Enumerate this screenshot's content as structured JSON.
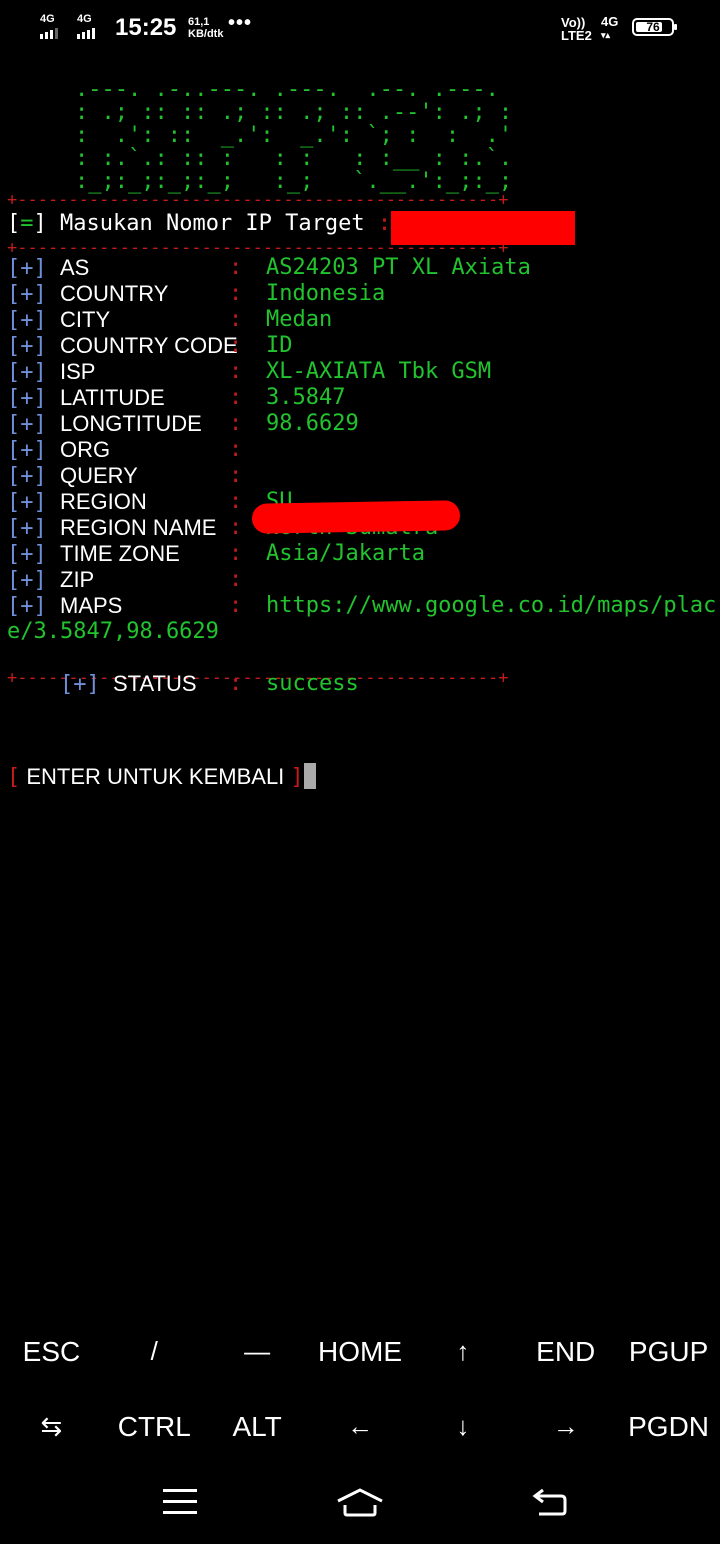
{
  "status_bar": {
    "sim1": "4G",
    "sim2": "4G",
    "time": "15:25",
    "speed_value": "61,1",
    "speed_unit": "KB/dtk",
    "more": "•••",
    "volte_top": "Vo))",
    "volte_bottom": "LTE2",
    "net_right": "4G",
    "battery": "76",
    "battery_level": 76
  },
  "terminal": {
    "ascii_art": [
      ".---. .-..---. .---.  .--. .---.",
      ": .; :: :: .; :: .; :: .--': .; :",
      ":  .': ::  _.':  _.': `; :  :  .'",
      ": :.`.: :: :   : :   : :__ : :.`.",
      ":_;:_;:_;:_;   :_;   `.__.':_;:_;"
    ],
    "dashes": "+-----------------------------------------------+",
    "prompt_bracket_open": "[",
    "prompt_mark": "=",
    "prompt_bracket_close": "]",
    "prompt_text": "Masukan Nomor IP Target",
    "prompt_colon": ":",
    "separator": ":",
    "rows": [
      {
        "mark": "[+]",
        "label": "AS",
        "value": "AS24203 PT XL Axiata"
      },
      {
        "mark": "[+]",
        "label": "COUNTRY",
        "value": "Indonesia"
      },
      {
        "mark": "[+]",
        "label": "CITY",
        "value": "Medan"
      },
      {
        "mark": "[+]",
        "label": "COUNTRY CODE",
        "value": "ID"
      },
      {
        "mark": "[+]",
        "label": "ISP",
        "value": "XL-AXIATA Tbk GSM"
      },
      {
        "mark": "[+]",
        "label": "LATITUDE",
        "value": "3.5847"
      },
      {
        "mark": "[+]",
        "label": "LONGTITUDE",
        "value": "98.6629"
      },
      {
        "mark": "[+]",
        "label": "ORG",
        "value": ""
      },
      {
        "mark": "[+]",
        "label": "QUERY",
        "value": ""
      },
      {
        "mark": "[+]",
        "label": "REGION",
        "value": "SU"
      },
      {
        "mark": "[+]",
        "label": "REGION NAME",
        "value": "North Sumatra"
      },
      {
        "mark": "[+]",
        "label": "TIME ZONE",
        "value": "Asia/Jakarta"
      },
      {
        "mark": "[+]",
        "label": "ZIP",
        "value": ""
      },
      {
        "mark": "[+]",
        "label": "MAPS",
        "value": "https://www.google.co.id/maps/plac"
      }
    ],
    "maps_wrap": "e/3.5847,98.6629",
    "status_row": {
      "mark": "[+]",
      "label": "STATUS",
      "value": "success"
    },
    "enter_open": "[",
    "enter_text": " ENTER UNTUK KEMBALI ",
    "enter_close": "]"
  },
  "extra_keys": {
    "row1": [
      "ESC",
      "/",
      "—",
      "HOME",
      "↑",
      "END",
      "PGUP"
    ],
    "row2": [
      "⇆",
      "CTRL",
      "ALT",
      "←",
      "↓",
      "→",
      "PGDN"
    ]
  },
  "nav_bar": {
    "icons": [
      "menu-icon",
      "home-icon",
      "back-icon"
    ]
  }
}
